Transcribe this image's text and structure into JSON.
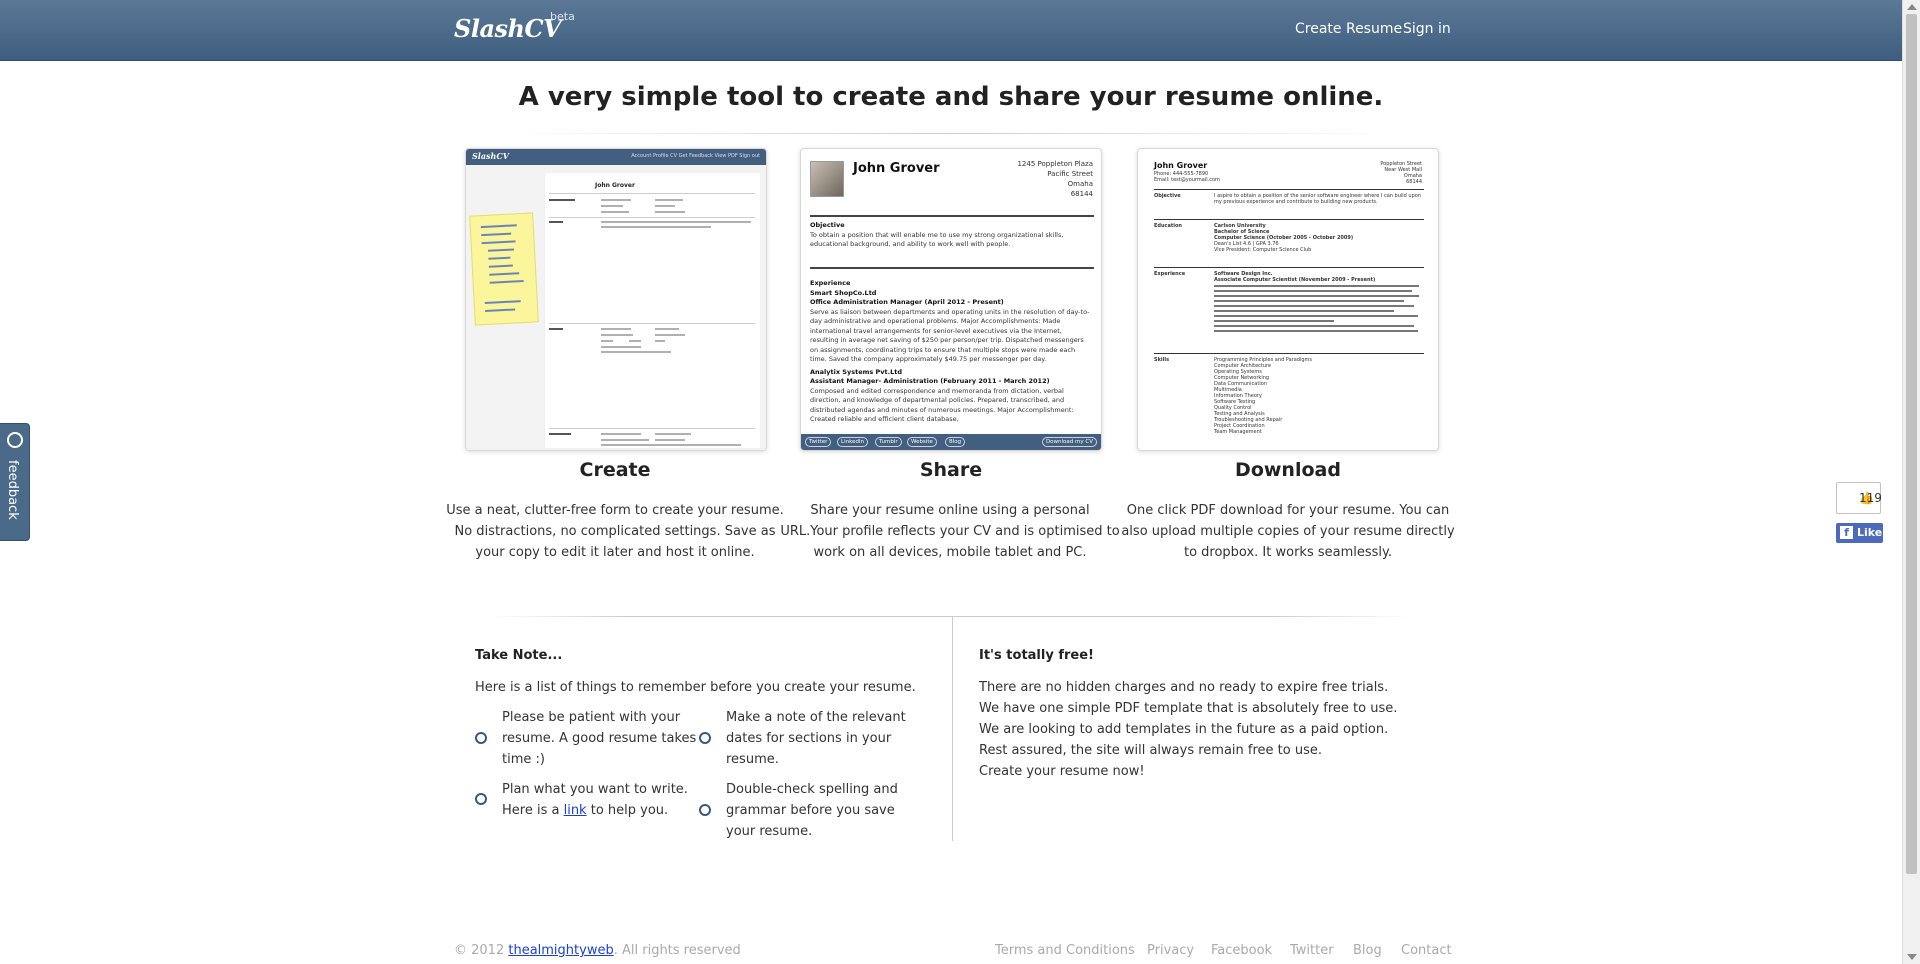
{
  "header": {
    "logo": "SlashCV",
    "beta": "beta",
    "nav": [
      "Create Resume",
      "Sign in"
    ]
  },
  "headline": "A very simple tool to create and share your resume online.",
  "features": [
    {
      "title": "Create",
      "desc": "Use a neat, clutter-free form to create your resume. No distractions, no complicated settings. Save as your copy to edit it later and host it online."
    },
    {
      "title": "Share",
      "desc": "Share your resume online using a personal URL.Your profile reflects your CV and is optimised to work on all devices, mobile tablet and PC."
    },
    {
      "title": "Download",
      "desc": "One click PDF download for your resume. You can also upload multiple copies of your resume directly to dropbox. It works seamlessly."
    }
  ],
  "preview_create": {
    "logo": "SlashCV",
    "nav": "Account   Profile   CV   Get Feedback   View PDF   Sign out",
    "name": "John Grover"
  },
  "preview_share": {
    "name": "John Grover",
    "address": [
      "1245 Poppleton Plaza",
      "Pacific Street",
      "Omaha",
      "68144"
    ],
    "objective_h": "Objective",
    "objective": "To obtain a position that will enable me to use my strong organizational skills, educational background, and ability to work well with people.",
    "experience_h": "Experience",
    "job1_company": "Smart ShopCo.Ltd",
    "job1_title": "Office Administration Manager (April 2012 - Present)",
    "job1_desc": "Serve as liaison between departments and operating units in the resolution of day-to-day administrative and operational problems. Major Accomplishments: Made international travel arrangements for senior-level executives via the Internet, resulting in average net saving of $250 per person/per trip. Dispatched messengers on assignments, coordinating trips to ensure that multiple stops were made each time. Saved the company approximately $49.75 per messenger per day.",
    "job2_company": "Analytix Systems Pvt.Ltd",
    "job2_title": "Assistant Manager- Administration (February 2011 - March 2012)",
    "job2_desc": "Composed and edited correspondence and memoranda from dictation, verbal direction, and knowledge of departmental policies. Prepared, transcribed, and distributed agendas and minutes of numerous meetings. Major Accomplishment: Created reliable and efficient client database,",
    "social": [
      "Twitter",
      "LinkedIn",
      "Tumblr",
      "Website",
      "Blog"
    ],
    "download": "Download my CV"
  },
  "preview_download": {
    "name": "John Grover",
    "contact": [
      "Phone: 444-555-7890",
      "Email: test@yourmail.com"
    ],
    "address": [
      "Poppleton Street",
      "Near West Mall",
      "Omaha",
      "68144"
    ],
    "objective_h": "Objective",
    "objective": "I aspire to obtain a position of the senior software engineer where I can build upon my previous experience and contribute to building new products.",
    "education_h": "Education",
    "education": [
      "Carlson University",
      "Bachelor of Science",
      "Computer Science (October 2005 - October 2009)",
      "Dean's List 4.6 | GPA 3.76",
      "Vice President: Computer Science Club"
    ],
    "experience_h": "Experience",
    "experience": [
      "Software Design Inc.",
      "Associate Computer Scientist (November 2009 - Present)"
    ],
    "skills_h": "Skills",
    "skills": [
      "Programming Principles and Paradigms",
      "Computer Architecture",
      "Operating Systems",
      "Computer Networking",
      "Data Communication",
      "Multimedia",
      "Information Theory",
      "Software Testing",
      "Quality Control",
      "Testing and Analysis",
      "Troubleshooting and Repair",
      "Project Coordination",
      "Team Management"
    ]
  },
  "take_note": {
    "title": "Take Note...",
    "intro": "Here is a list of things to remember before you create your resume.",
    "items": [
      "Please be patient with your resume. A good resume takes time :)",
      "Make a note of the relevant dates for sections in your resume.",
      "Plan what you want to write.",
      "Double-check spelling and grammar before you save your resume."
    ],
    "item3_line2_pre": "Here is a",
    "item3_link": "link",
    "item3_line2_post": "to help you."
  },
  "free": {
    "title": "It's totally free!",
    "lines": [
      "There are no hidden charges and no ready to expire free trials.",
      "We have one simple PDF template that is absolutely free to use.",
      "We are looking to add templates in the future as a paid option.",
      "Rest assured, the site will always remain free to use.",
      "Create your resume now!"
    ]
  },
  "feedback": "feedback",
  "fb": {
    "count": "119",
    "like": "Like"
  },
  "footer": {
    "copy_pre": "© 2012",
    "copy_link": "thealmightyweb",
    "copy_post": ". All rights reserved",
    "links": [
      "Terms and Conditions",
      "Privacy",
      "Facebook",
      "Twitter",
      "Blog",
      "Contact"
    ]
  }
}
